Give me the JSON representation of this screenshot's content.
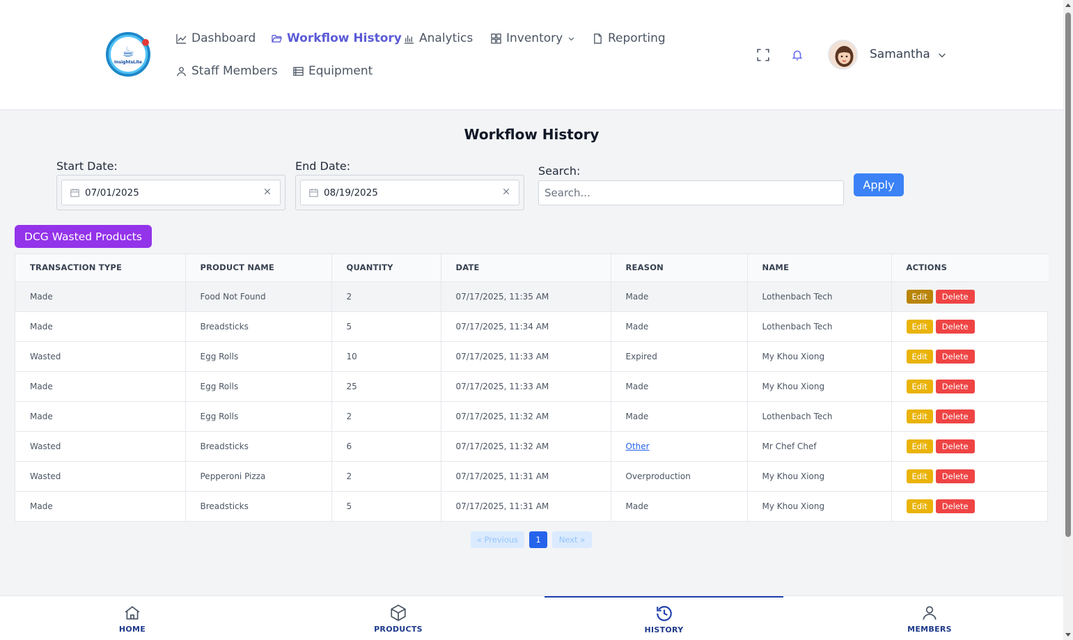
{
  "app": {
    "logo_text": "InsightsLite"
  },
  "nav": {
    "items": [
      {
        "label": "Dashboard"
      },
      {
        "label": "Workflow History"
      },
      {
        "label": "Analytics"
      },
      {
        "label": "Inventory"
      },
      {
        "label": "Reporting"
      },
      {
        "label": "Staff Members"
      },
      {
        "label": "Equipment"
      }
    ],
    "active": "Workflow History"
  },
  "user": {
    "name": "Samantha"
  },
  "page": {
    "title": "Workflow History"
  },
  "filters": {
    "start_label": "Start Date:",
    "start_value": "07/01/2025",
    "end_label": "End Date:",
    "end_value": "08/19/2025",
    "search_label": "Search:",
    "search_placeholder": "Search...",
    "search_value": "",
    "apply_label": "Apply"
  },
  "wasted_button": "DCG Wasted Products",
  "table": {
    "headers": [
      "TRANSACTION TYPE",
      "PRODUCT NAME",
      "QUANTITY",
      "DATE",
      "REASON",
      "NAME",
      "ACTIONS"
    ],
    "edit_label": "Edit",
    "delete_label": "Delete",
    "rows": [
      {
        "type": "Made",
        "product": "Food Not Found",
        "qty": "2",
        "date": "07/17/2025, 11:35 AM",
        "reason": "Made",
        "name": "Lothenbach Tech"
      },
      {
        "type": "Made",
        "product": "Breadsticks",
        "qty": "5",
        "date": "07/17/2025, 11:34 AM",
        "reason": "Made",
        "name": "Lothenbach Tech"
      },
      {
        "type": "Wasted",
        "product": "Egg Rolls",
        "qty": "10",
        "date": "07/17/2025, 11:33 AM",
        "reason": "Expired",
        "name": "My Khou Xiong"
      },
      {
        "type": "Made",
        "product": "Egg Rolls",
        "qty": "25",
        "date": "07/17/2025, 11:33 AM",
        "reason": "Made",
        "name": "My Khou Xiong"
      },
      {
        "type": "Made",
        "product": "Egg Rolls",
        "qty": "2",
        "date": "07/17/2025, 11:32 AM",
        "reason": "Made",
        "name": "Lothenbach Tech"
      },
      {
        "type": "Wasted",
        "product": "Breadsticks",
        "qty": "6",
        "date": "07/17/2025, 11:32 AM",
        "reason": "Other",
        "name": "Mr Chef Chef"
      },
      {
        "type": "Wasted",
        "product": "Pepperoni Pizza",
        "qty": "2",
        "date": "07/17/2025, 11:31 AM",
        "reason": "Overproduction",
        "name": "My Khou Xiong"
      },
      {
        "type": "Made",
        "product": "Breadsticks",
        "qty": "5",
        "date": "07/17/2025, 11:31 AM",
        "reason": "Made",
        "name": "My Khou Xiong"
      }
    ]
  },
  "pagination": {
    "prev": "« Previous",
    "current": "1",
    "next": "Next »"
  },
  "bottom_nav": {
    "items": [
      {
        "label": "HOME",
        "icon": "home-icon"
      },
      {
        "label": "PRODUCTS",
        "icon": "box-icon"
      },
      {
        "label": "HISTORY",
        "icon": "history-icon"
      },
      {
        "label": "MEMBERS",
        "icon": "user-icon"
      }
    ],
    "active": "HISTORY"
  },
  "colors": {
    "accent": "#5b5bd6",
    "apply": "#3b82f6",
    "wasted_button": "#9333ea",
    "edit": "#eab308",
    "delete": "#ef4444"
  }
}
